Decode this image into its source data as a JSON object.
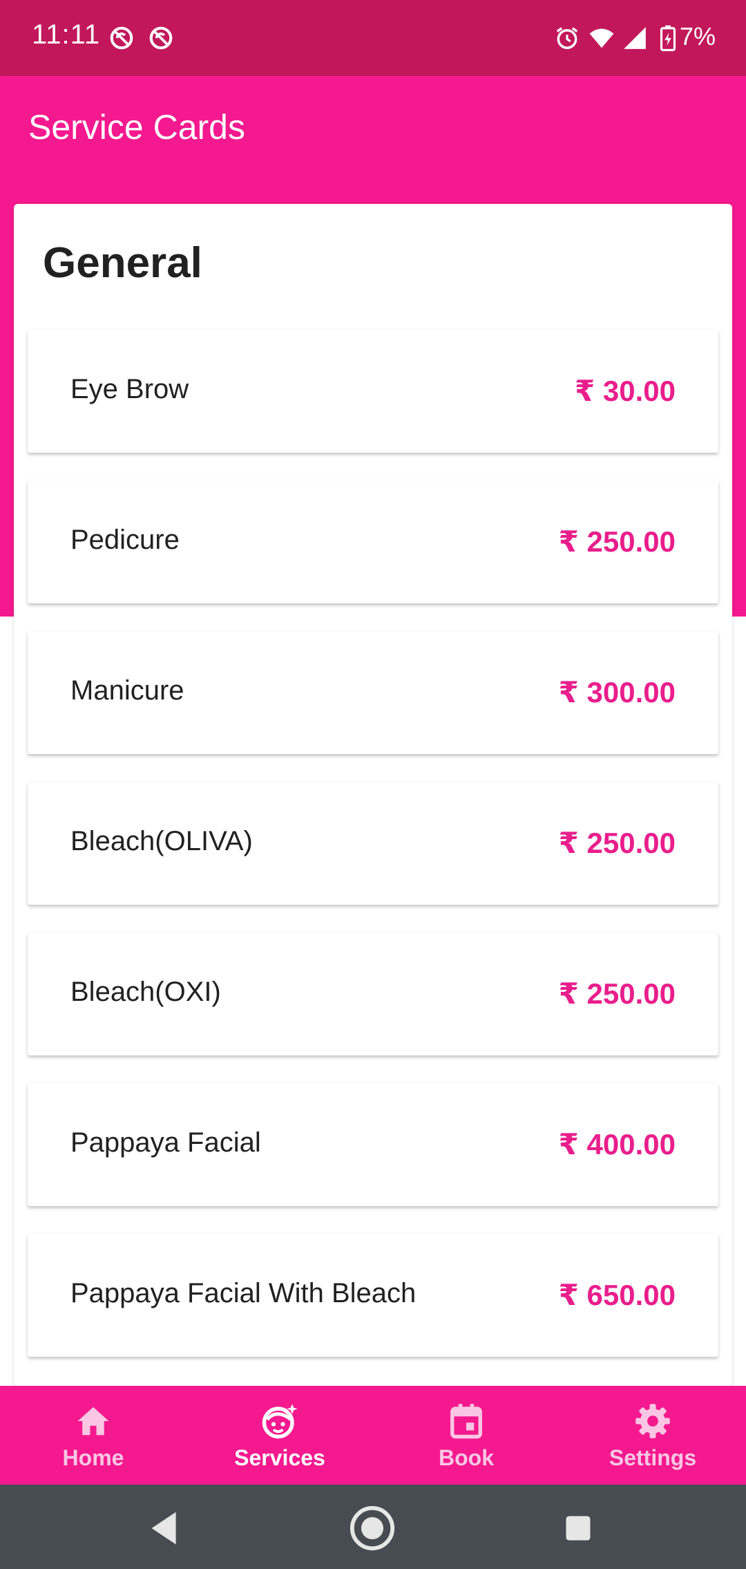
{
  "status_bar": {
    "time": "11:11",
    "battery_percent": "7%",
    "icons": [
      "sync-off-icon",
      "sync-off-icon",
      "alarm-icon",
      "wifi-icon",
      "cellular-signal-icon",
      "battery-charging-icon"
    ]
  },
  "app_bar": {
    "title": "Service Cards"
  },
  "section": {
    "title": "General",
    "items": [
      {
        "name": "Eye Brow",
        "price": "₹ 30.00"
      },
      {
        "name": "Pedicure",
        "price": "₹ 250.00"
      },
      {
        "name": "Manicure",
        "price": "₹ 300.00"
      },
      {
        "name": "Bleach(OLIVA)",
        "price": "₹ 250.00"
      },
      {
        "name": "Bleach(OXI)",
        "price": "₹ 250.00"
      },
      {
        "name": "Pappaya Facial",
        "price": "₹ 400.00"
      },
      {
        "name": "Pappaya Facial With Bleach",
        "price": "₹ 650.00"
      }
    ]
  },
  "bottom_nav": {
    "items": [
      {
        "label": "Home",
        "icon": "home-icon"
      },
      {
        "label": "Services",
        "icon": "face-icon",
        "active": true
      },
      {
        "label": "Book",
        "icon": "calendar-icon"
      },
      {
        "label": "Settings",
        "icon": "gear-icon"
      }
    ]
  },
  "system_nav": {
    "buttons": [
      "back-icon",
      "home-circle-icon",
      "recents-icon"
    ]
  },
  "colors": {
    "status_bar": "#c2185b",
    "primary": "#f4198f",
    "price": "#e91e8c",
    "system_nav": "#464c51"
  }
}
